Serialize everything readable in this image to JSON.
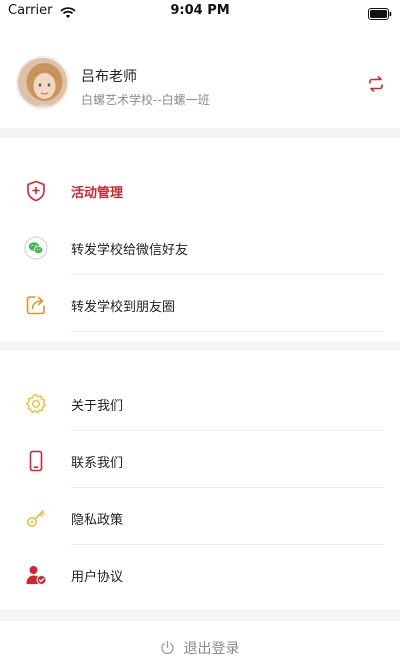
{
  "status_bar": {
    "carrier": "Carrier",
    "time": "9:04 PM"
  },
  "profile": {
    "name": "吕布老师",
    "subtitle": "白螺艺术学校--白螺一班",
    "switch_icon": "switch-arrows-icon"
  },
  "menu_group_1": [
    {
      "label": "活动管理",
      "icon": "shield-plus-icon",
      "active": true
    },
    {
      "label": "转发学校给微信好友",
      "icon": "wechat-icon"
    },
    {
      "label": "转发学校到朋友圈",
      "icon": "share-out-icon"
    }
  ],
  "menu_group_2": [
    {
      "label": "关于我们",
      "icon": "gear-icon"
    },
    {
      "label": "联系我们",
      "icon": "phone-icon"
    },
    {
      "label": "隐私政策",
      "icon": "key-icon"
    },
    {
      "label": "用户协议",
      "icon": "user-check-icon"
    }
  ],
  "logout": {
    "label": "退出登录",
    "icon": "power-icon"
  },
  "colors": {
    "accent": "#d0262f",
    "wechat": "#3eb847",
    "gold": "#e6c33a",
    "orange": "#e8931f"
  }
}
